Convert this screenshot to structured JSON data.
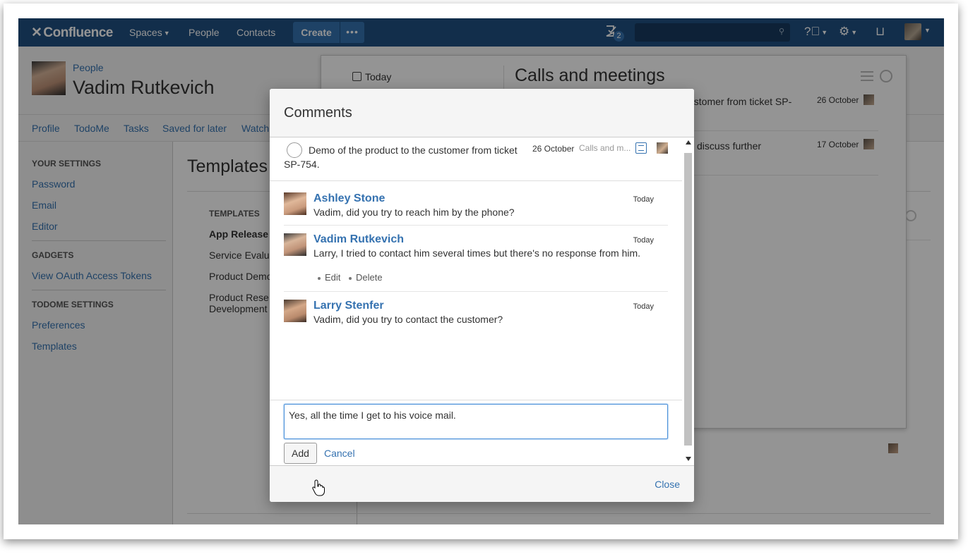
{
  "topnav": {
    "logo": "Confluence",
    "spaces": "Spaces",
    "people": "People",
    "contacts": "Contacts",
    "create": "Create",
    "more": "•••",
    "task_badge": "2",
    "search_placeholder": ""
  },
  "header": {
    "breadcrumb": "People",
    "title": "Vadim Rutkevich"
  },
  "subnav": [
    "Profile",
    "TodoMe",
    "Tasks",
    "Saved for later",
    "Watch"
  ],
  "sidebar": {
    "your_settings": "YOUR SETTINGS",
    "your_settings_items": [
      "Password",
      "Email",
      "Editor"
    ],
    "gadgets": "GADGETS",
    "gadgets_items": [
      "View OAuth Access Tokens"
    ],
    "todome_settings": "TODOME SETTINGS",
    "todome_items": [
      "Preferences",
      "Templates"
    ]
  },
  "main": {
    "title": "Templates",
    "templates_head": "TEMPLATES",
    "templates": [
      "App Release",
      "Service Evalu",
      "Product Demo",
      "Product Rese",
      "Development"
    ]
  },
  "panel": {
    "today": "Today",
    "title": "Calls and meetings",
    "rows": [
      {
        "text": "ustomer from ticket SP-",
        "date": "26 October"
      },
      {
        "text": "discuss further",
        "date": "17 October"
      }
    ]
  },
  "dialog": {
    "title": "Comments",
    "task": {
      "text": "Demo of the product to the customer from ticket SP-754.",
      "date": "26 October",
      "space": "Calls and m..."
    },
    "comments": [
      {
        "author": "Ashley Stone",
        "date": "Today",
        "text": "Vadim, did you try to reach him by the phone?"
      },
      {
        "author": "Vadim Rutkevich",
        "date": "Today",
        "text": "Larry, I tried to contact him several times but there's no response from him.",
        "edit": "Edit",
        "delete": "Delete"
      },
      {
        "author": "Larry Stenfer",
        "date": "Today",
        "text": "Vadim, did you try to contact the customer?"
      }
    ],
    "compose_value": "Yes, all the time I get to his voice mail.",
    "add": "Add",
    "cancel": "Cancel",
    "close": "Close"
  },
  "colors": {
    "nav_bg": "#205081",
    "link": "#3572b0",
    "create_bg": "#3572b0"
  }
}
